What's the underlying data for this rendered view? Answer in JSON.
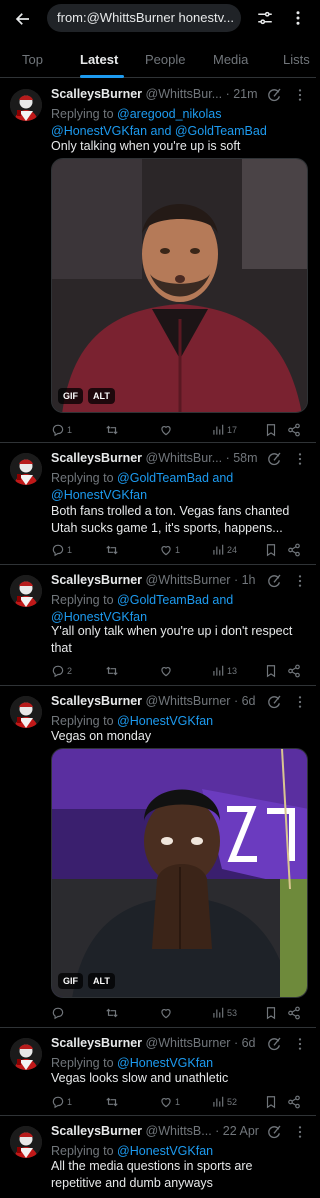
{
  "search": {
    "query": "from:@WhittsBurner honestv..."
  },
  "tabs": [
    {
      "label": "Top"
    },
    {
      "label": "Latest"
    },
    {
      "label": "People"
    },
    {
      "label": "Media"
    },
    {
      "label": "Lists"
    }
  ],
  "colors": {
    "accent": "#1d9bf0",
    "muted": "#71767b",
    "text": "#e7e9ea",
    "divider": "#2f3336"
  },
  "tweets": [
    {
      "name": "ScalleysBurner",
      "handle": "@WhittsBur...",
      "time": "· 21m",
      "replying_prefix": "Replying to",
      "replying_line1": "@aregood_nikolas",
      "replying_line2": "@HonestVGKfan and @GoldTeamBad",
      "text": "Only talking when you're up is soft",
      "media": {
        "badges": [
          "GIF",
          "ALT"
        ]
      },
      "stats": {
        "replies": "1",
        "reposts": "",
        "likes": "",
        "views": "17"
      }
    },
    {
      "name": "ScalleysBurner",
      "handle": "@WhittsBur...",
      "time": "· 58m",
      "replying_prefix": "Replying to",
      "replying_line1": "@GoldTeamBad and",
      "replying_line2": "@HonestVGKfan",
      "text_line1": "Both fans trolled a ton. Vegas fans chanted",
      "text_line2": "Utah sucks game 1, it's sports, happens...",
      "stats": {
        "replies": "1",
        "reposts": "",
        "likes": "1",
        "views": "24"
      }
    },
    {
      "name": "ScalleysBurner",
      "handle": "@WhittsBurner",
      "time": "· 1h",
      "replying_prefix": "Replying to",
      "replying_line1": "@GoldTeamBad and",
      "replying_line2": "@HonestVGKfan",
      "text_line1": "Y'all only talk when you're up i don't respect",
      "text_line2": "that",
      "stats": {
        "replies": "2",
        "reposts": "",
        "likes": "",
        "views": "13"
      }
    },
    {
      "name": "ScalleysBurner",
      "handle": "@WhittsBurner",
      "time": "· 6d",
      "replying_prefix": "Replying to",
      "replying_line1": "@HonestVGKfan",
      "text": "Vegas on monday",
      "media": {
        "badges": [
          "GIF",
          "ALT"
        ]
      },
      "stats": {
        "replies": "",
        "reposts": "",
        "likes": "",
        "views": "53"
      }
    },
    {
      "name": "ScalleysBurner",
      "handle": "@WhittsBurner",
      "time": "· 6d",
      "replying_prefix": "Replying to",
      "replying_line1": "@HonestVGKfan",
      "text": "Vegas looks slow and unathletic",
      "stats": {
        "replies": "1",
        "reposts": "",
        "likes": "1",
        "views": "52"
      }
    },
    {
      "name": "ScalleysBurner",
      "handle": "@WhittsB...",
      "time": "· 22 Apr",
      "replying_prefix": "Replying to",
      "replying_line1": "@HonestVGKfan",
      "text_line1": "All the media questions in sports are",
      "text_line2": "repetitive and dumb anyways"
    }
  ]
}
